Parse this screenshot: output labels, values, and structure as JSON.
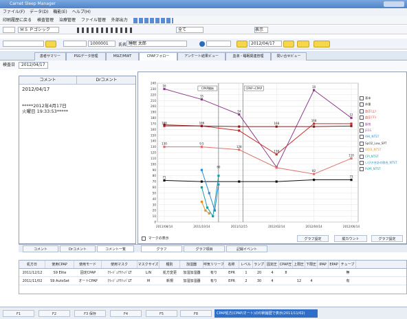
{
  "window": {
    "title": "Carnet Sleep Manager"
  },
  "menu": [
    "ファイル(F)",
    "データ(D)",
    "機能(E)",
    "ヘルプ(H)"
  ],
  "toolbar": {
    "items": [
      "印刷履歴に戻る",
      "検査管理",
      "治療管理",
      "ファイル管理",
      "外部出力"
    ]
  },
  "format_bar": {
    "font": "ＭＳ Ｐゴシック",
    "all_label": "全て",
    "display": "表示"
  },
  "patient": {
    "id_value": "1000001",
    "name_label": "氏名",
    "name_value": "睡眠 太郎",
    "date_value": "2012/04/17"
  },
  "tabs": [
    "患者サマリー",
    "PSGデータ管理",
    "MSLT/MWT",
    "CPAPフォロー",
    "アンケート結果ビュー",
    "血液・睡眠関連管理",
    "問い合せビュー"
  ],
  "date_bar": {
    "label": "検査日",
    "value": "2012/04/17"
  },
  "left_panel": {
    "headers": [
      "コメント",
      "Drコメント"
    ],
    "date": "2012/04/17",
    "entry_line1": "*****2012年4月17日",
    "entry_line2": "火曜日 19:33:53*****"
  },
  "chart_data": {
    "type": "line",
    "x": [
      "2011/08/14",
      "2011/10/14",
      "2011/12/15",
      "2012/02/14",
      "2012/04/14",
      "2012/06/14"
    ],
    "ylim": [
      0,
      240
    ],
    "y_ticks": [
      0,
      10,
      20,
      30,
      40,
      50,
      60,
      70,
      80,
      90,
      100,
      110,
      120,
      130,
      140,
      150,
      160,
      170,
      180,
      190,
      200,
      210,
      220,
      230,
      240
    ],
    "annotations": [
      {
        "label": "CPAP開始"
      },
      {
        "label": "CPAP→CPAP"
      }
    ],
    "series": [
      {
        "color": "#8b3a8b",
        "points": [
          [
            0,
            230
          ],
          [
            1,
            212
          ],
          [
            2,
            186
          ],
          [
            3,
            95
          ],
          [
            4,
            228
          ],
          [
            5,
            180
          ]
        ]
      },
      {
        "color": "#cc2a2a",
        "points": [
          [
            0,
            166
          ],
          [
            1,
            166
          ],
          [
            2,
            158
          ],
          [
            3,
            117
          ],
          [
            4,
            170
          ],
          [
            5,
            170
          ]
        ]
      },
      {
        "color": "#e07070",
        "points": [
          [
            0,
            130
          ],
          [
            1,
            130
          ],
          [
            2,
            125
          ],
          [
            3,
            94
          ],
          [
            4,
            83
          ],
          [
            5,
            110
          ]
        ]
      },
      {
        "color": "#8b1a1a",
        "points": [
          [
            0,
            168
          ],
          [
            1,
            166
          ],
          [
            2,
            165
          ],
          [
            3,
            165
          ],
          [
            4,
            165
          ],
          [
            5,
            166
          ]
        ]
      },
      {
        "color": "#111111",
        "points": [
          [
            0,
            72
          ],
          [
            1,
            70
          ],
          [
            2,
            70
          ],
          [
            3,
            70
          ],
          [
            4,
            73
          ],
          [
            5,
            73
          ]
        ]
      },
      {
        "color": "#2f8bd0",
        "points": [
          [
            1,
            90
          ],
          [
            1.2,
            50
          ],
          [
            1.35,
            20
          ],
          [
            1.45,
            65
          ]
        ]
      },
      {
        "color": "#1a9c9c",
        "points": [
          [
            1,
            60
          ],
          [
            1.15,
            25
          ],
          [
            1.3,
            10
          ],
          [
            1.45,
            80
          ]
        ]
      },
      {
        "color": "#e09030",
        "points": [
          [
            1,
            35
          ],
          [
            1.1,
            20
          ],
          [
            1.2,
            15
          ]
        ]
      }
    ],
    "data_labels": [
      {
        "x": 0,
        "y": 230,
        "text": "16"
      },
      {
        "x": 1,
        "y": 212,
        "text": "15"
      },
      {
        "x": 2,
        "y": 186,
        "text": "14"
      },
      {
        "x": 4,
        "y": 228,
        "text": "10"
      },
      {
        "x": 5,
        "y": 180,
        "text": "12"
      },
      {
        "x": 0,
        "y": 166,
        "text": "166"
      },
      {
        "x": 1,
        "y": 166,
        "text": "166"
      },
      {
        "x": 3,
        "y": 165,
        "text": "168"
      },
      {
        "x": 4,
        "y": 170,
        "text": "168"
      },
      {
        "x": 0,
        "y": 130,
        "text": "130"
      },
      {
        "x": 1,
        "y": 130,
        "text": "9.5"
      },
      {
        "x": 2,
        "y": 125,
        "text": "128"
      },
      {
        "x": 3,
        "y": 117,
        "text": "138"
      },
      {
        "x": 5,
        "y": 110,
        "text": "110"
      },
      {
        "x": 0,
        "y": 72,
        "text": "71"
      },
      {
        "x": 5,
        "y": 73,
        "text": "73"
      },
      {
        "x": 1.45,
        "y": 90,
        "text": "60"
      },
      {
        "x": 4,
        "y": 83,
        "text": "82"
      }
    ]
  },
  "legend": [
    {
      "label": "基本",
      "color": "#333333"
    },
    {
      "label": "体重",
      "color": "#333333"
    },
    {
      "label": "血圧(上)",
      "color": "#cc2a2a"
    },
    {
      "label": "血圧(下)",
      "color": "#cc2a2a"
    },
    {
      "label": "脈拍",
      "color": "#8b3a8b"
    },
    {
      "label": "JESS",
      "color": "#b060b0"
    },
    {
      "label": "AHI_NTST",
      "color": "#2f8bd0"
    },
    {
      "label": "SpO2_Low_SPT",
      "color": "#333333"
    },
    {
      "label": "ODI3_NTST",
      "color": "#e09030"
    },
    {
      "label": "CPI_NTST",
      "color": "#1a9c9c"
    },
    {
      "label": "いびき合計の割合_NTST",
      "color": "#2f8bd0"
    },
    {
      "label": "PLMI_NTST",
      "color": "#1a9c9c"
    }
  ],
  "chart_footer": {
    "marker_label": "マークの表示",
    "btn_graph_settings": "グラフ設定",
    "btn_reset": "縦カウント",
    "btn_graph_detail": "グラフ設定"
  },
  "bottom_tabs": [
    "コメント",
    "Drコメント",
    "コメント一覧",
    "グラフ",
    "グラフ項目",
    "記録イベント"
  ],
  "table": {
    "headers": [
      "処方日",
      "使用CPAP",
      "使用モード",
      "使用マスク",
      "マスクサイズ",
      "種別",
      "加湿器",
      "呼気リリーフ",
      "名称",
      "レベル",
      "ランプ",
      "固定圧",
      "CPAP圧",
      "上限圧",
      "下限圧",
      "IPAP",
      "EPAP",
      "チューブ"
    ],
    "rows": [
      [
        "2011/12/12",
        "S9 Elite",
        "固定CPAP",
        "ｸﾗｰｼﾞｭｱｸﾃｨﾊﾞLT",
        "L/N",
        "処方変更",
        "加湿加湿器",
        "有り",
        "EPR",
        "1",
        "20",
        "4",
        "8",
        "",
        "",
        "",
        "",
        "無"
      ],
      [
        "2011/11/02",
        "S9 AutoSet",
        "オートCPAP",
        "ｸﾗｰｼﾞｭｱｸﾃｨﾊﾞLT",
        "M",
        "新規",
        "加湿加湿器",
        "有り",
        "EPR",
        "2",
        "30",
        "4",
        "",
        "12",
        "4",
        "",
        "",
        "有"
      ]
    ]
  },
  "status_bar": {
    "keys": [
      "F1",
      "F2",
      "F3 保存",
      "F4",
      "F5",
      "F8"
    ],
    "message": "CPAP処方(CPAP/オート)の印刷履歴で表示(2011/11/02)"
  }
}
